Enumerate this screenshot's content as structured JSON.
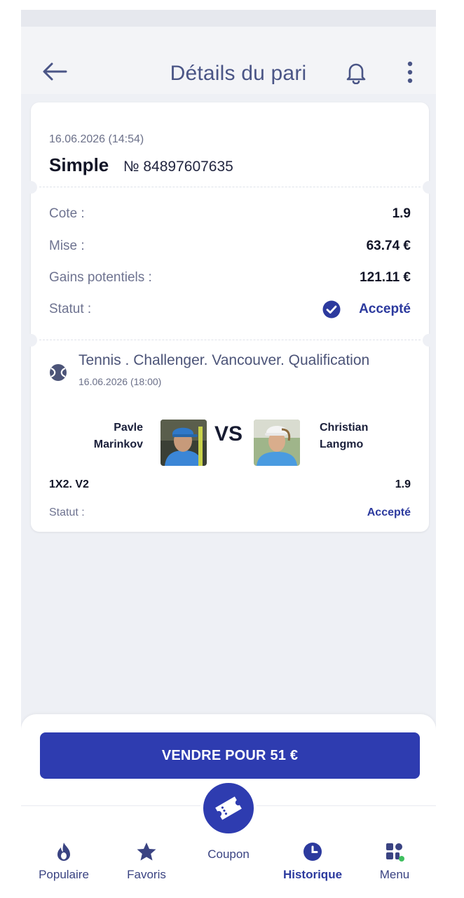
{
  "header": {
    "title": "Détails du pari"
  },
  "bet": {
    "date": "16.06.2026 (14:54)",
    "type": "Simple",
    "number": "№ 84897607635",
    "rows": [
      {
        "label": "Cote :",
        "value": "1.9"
      },
      {
        "label": "Mise :",
        "value": "63.74 €"
      },
      {
        "label": "Gains potentiels :",
        "value": "121.11 €"
      },
      {
        "label": "Statut :",
        "value": "Accepté"
      }
    ]
  },
  "event": {
    "league": "Tennis . Challenger. Vancouver. Qualification",
    "date": "16.06.2026 (18:00)",
    "player1": {
      "first": "Pavle",
      "last": "Marinkov"
    },
    "vs": "VS",
    "player2": {
      "first": "Christian",
      "last": "Langmo"
    },
    "market": "1X2. V2",
    "odd": "1.9",
    "status_label": "Statut :",
    "status_value": "Accepté"
  },
  "sell_button": "VENDRE POUR 51 €",
  "nav": [
    {
      "label": "Populaire",
      "icon": "flame-icon"
    },
    {
      "label": "Favoris",
      "icon": "star-icon"
    },
    {
      "label": "Coupon",
      "icon": "ticket-icon"
    },
    {
      "label": "Historique",
      "icon": "clock-icon",
      "active": true
    },
    {
      "label": "Menu",
      "icon": "grid-icon"
    }
  ],
  "colors": {
    "accent": "#2e3cb0",
    "accepted": "#2c3a9e",
    "background": "#eef0f5"
  }
}
